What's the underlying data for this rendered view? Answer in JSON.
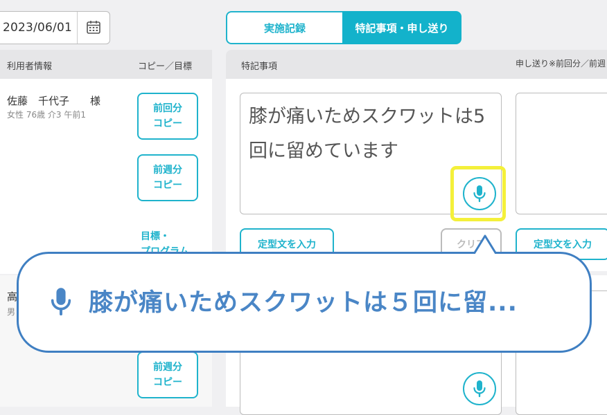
{
  "date": {
    "value": "2023/06/01",
    "calendar_icon": "calendar-icon"
  },
  "tabs": [
    {
      "label": "実施記録",
      "active": false
    },
    {
      "label": "特記事項・申し送り",
      "active": true
    }
  ],
  "left_header": {
    "user_info": "利用者情報",
    "copy_goal": "コピー／目標"
  },
  "users": [
    {
      "name": "佐藤　千代子　　様",
      "meta": "女性 76歳 介3 午前1"
    },
    {
      "name": "高",
      "meta": "男"
    }
  ],
  "buttons": {
    "prev_copy": [
      "前回分",
      "コピー"
    ],
    "prev_week_copy": [
      "前週分",
      "コピー"
    ],
    "goal_program": [
      "目標・",
      "プログラム"
    ],
    "template_input": "定型文を入力",
    "clear": "クリア",
    "template_input_2": "定型文を入力"
  },
  "right_header": {
    "notes": "特記事項",
    "handover": "申し送り※前回分／前週"
  },
  "note_text": "膝が痛いためスクワットは5回に留めています",
  "callout_text": "膝が痛いためスクワットは５回に留...",
  "colors": {
    "accent": "#13b2cb",
    "highlight": "#f4f03a",
    "callout": "#3f7fc2"
  }
}
